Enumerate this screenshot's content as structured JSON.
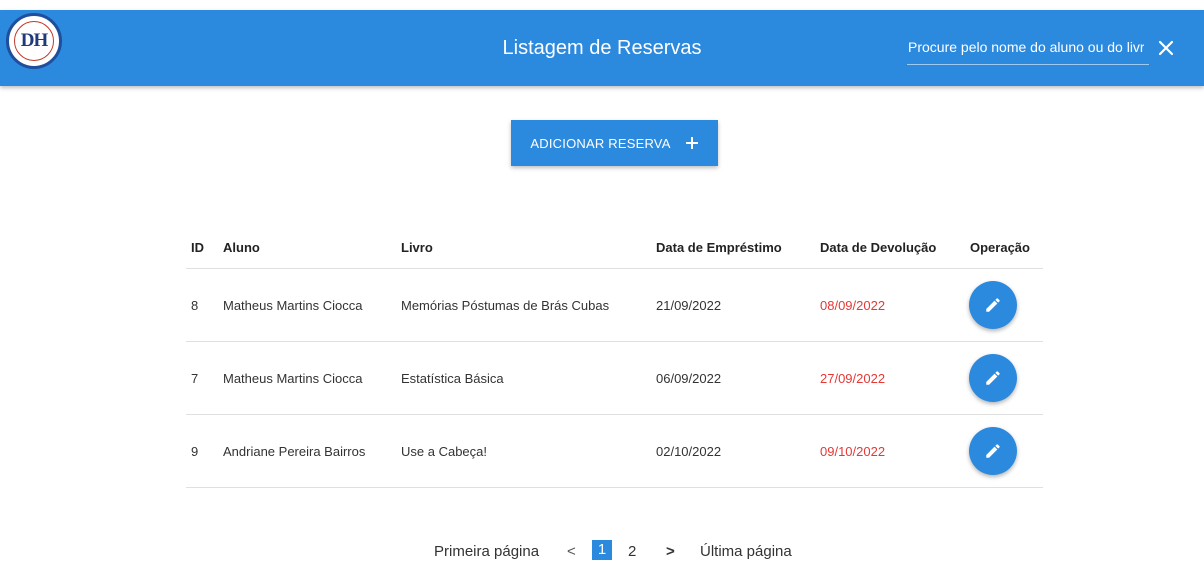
{
  "header": {
    "title": "Listagem de Reservas",
    "logo_text": "DH",
    "search_placeholder": "Procure pelo nome do aluno ou do livro",
    "close_icon": "close-icon"
  },
  "actions": {
    "add_label": "ADICIONAR RESERVA",
    "add_icon": "plus-icon"
  },
  "table": {
    "columns": [
      "ID",
      "Aluno",
      "Livro",
      "Data de Empréstimo",
      "Data de Devolução",
      "Operação"
    ],
    "rows": [
      {
        "id": "8",
        "aluno": "Matheus Martins Ciocca",
        "livro": "Memórias Póstumas de Brás Cubas",
        "emprestimo": "21/09/2022",
        "devolucao": "08/09/2022"
      },
      {
        "id": "7",
        "aluno": "Matheus Martins Ciocca",
        "livro": "Estatística Básica",
        "emprestimo": "06/09/2022",
        "devolucao": "27/09/2022"
      },
      {
        "id": "9",
        "aluno": "Andriane Pereira Bairros",
        "livro": "Use a Cabeça!",
        "emprestimo": "02/10/2022",
        "devolucao": "09/10/2022"
      }
    ],
    "edit_icon": "pencil-icon"
  },
  "pagination": {
    "first": "Primeira página",
    "prev": "<",
    "pages": [
      "1",
      "2"
    ],
    "current": "1",
    "next": ">",
    "last": "Última página"
  },
  "colors": {
    "primary": "#2b89de",
    "overdue": "#e53935"
  }
}
